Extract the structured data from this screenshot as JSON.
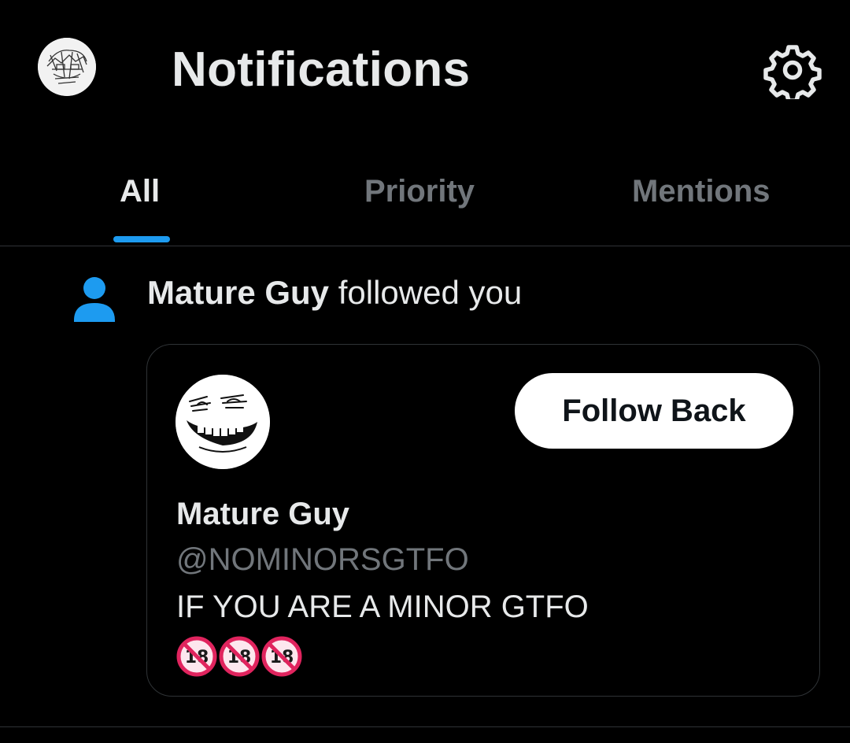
{
  "header": {
    "title": "Notifications",
    "avatar_icon": "user-avatar-sketch",
    "settings_icon": "gear-icon"
  },
  "tabs": [
    {
      "label": "All",
      "active": true
    },
    {
      "label": "Priority",
      "active": false
    },
    {
      "label": "Mentions",
      "active": false
    }
  ],
  "notification": {
    "type_icon": "person-icon",
    "actor_name": "Mature Guy",
    "action_text": "followed you",
    "card": {
      "display_name": "Mature Guy",
      "handle": "@NOMINORSGTFO",
      "bio": "IF YOU ARE A MINOR GTFO",
      "bio_emojis": [
        "no-one-under-18-icon",
        "no-one-under-18-icon",
        "no-one-under-18-icon"
      ],
      "follow_button_label": "Follow Back"
    }
  },
  "colors": {
    "background": "#000000",
    "text_primary": "#e7e9ea",
    "text_secondary": "#71767b",
    "accent": "#1d9bf0",
    "divider": "#2f3336",
    "emoji_red": "#e0245e"
  }
}
